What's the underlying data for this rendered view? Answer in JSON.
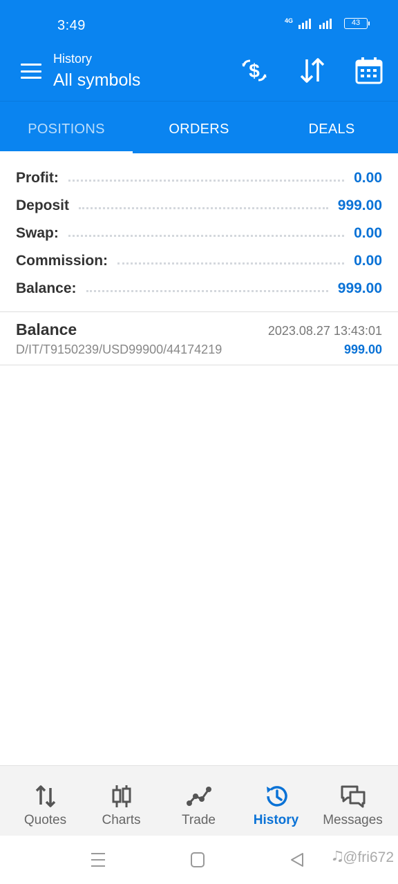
{
  "status_bar": {
    "time": "3:49",
    "network": "4G",
    "battery": "43"
  },
  "app_bar": {
    "subtitle": "History",
    "title": "All symbols",
    "icons": [
      "menu-icon",
      "currency-exchange-icon",
      "sort-icon",
      "calendar-icon"
    ]
  },
  "tabs": [
    {
      "label": "POSITIONS",
      "selected": true
    },
    {
      "label": "ORDERS",
      "selected": false
    },
    {
      "label": "DEALS",
      "selected": false
    }
  ],
  "summary": [
    {
      "label": "Profit:",
      "value": "0.00"
    },
    {
      "label": "Deposit",
      "value": "999.00"
    },
    {
      "label": "Swap:",
      "value": "0.00"
    },
    {
      "label": "Commission:",
      "value": "0.00"
    },
    {
      "label": "Balance:",
      "value": "999.00"
    }
  ],
  "deals": [
    {
      "title": "Balance",
      "time": "2023.08.27 13:43:01",
      "comment": "D/IT/T9150239/USD99900/44174219",
      "amount": "999.00"
    }
  ],
  "bottom_nav": [
    {
      "label": "Quotes",
      "icon": "quotes-icon",
      "active": false
    },
    {
      "label": "Charts",
      "icon": "charts-icon",
      "active": false
    },
    {
      "label": "Trade",
      "icon": "trade-icon",
      "active": false
    },
    {
      "label": "History",
      "icon": "history-icon",
      "active": true
    },
    {
      "label": "Messages",
      "icon": "messages-icon",
      "active": false
    }
  ],
  "watermark": "🎝@fri672",
  "colors": {
    "primary": "#0a84f0",
    "value_blue": "#0a72d6"
  }
}
